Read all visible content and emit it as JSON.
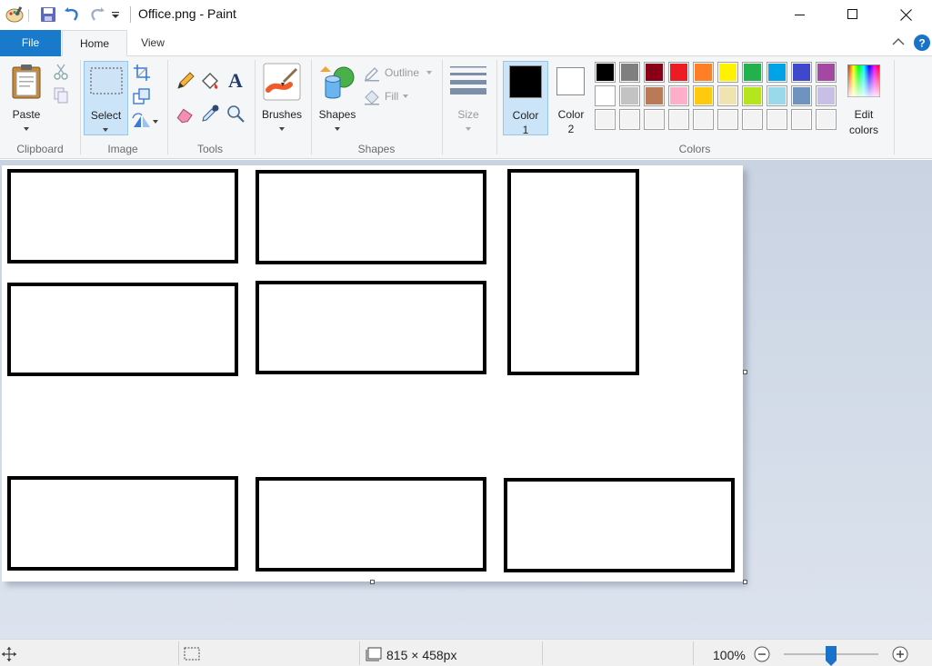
{
  "window": {
    "title": "Office.png - Paint",
    "minimize": "—",
    "maximize": "☐",
    "close": "✕"
  },
  "tabs": {
    "file": "File",
    "home": "Home",
    "view": "View"
  },
  "ribbon": {
    "clipboard": {
      "label": "Clipboard",
      "paste": "Paste"
    },
    "image": {
      "label": "Image",
      "select": "Select"
    },
    "tools": {
      "label": "Tools"
    },
    "brushes": {
      "label": "Brushes"
    },
    "shapes": {
      "label": "Shapes",
      "shapes": "Shapes",
      "outline": "Outline",
      "fill": "Fill"
    },
    "size": {
      "label": "Size"
    },
    "colors": {
      "label": "Colors",
      "color1": "Color",
      "color1_num": "1",
      "color2": "Color",
      "color2_num": "2",
      "edit": "Edit",
      "edit2": "colors",
      "color1_value": "#000000",
      "color2_value": "#ffffff",
      "palette_row1": [
        "#000000",
        "#7f7f7f",
        "#880015",
        "#ed1c24",
        "#ff7f27",
        "#fff200",
        "#22b14c",
        "#00a2e8",
        "#3f48cc",
        "#a349a4"
      ],
      "palette_row2": [
        "#ffffff",
        "#c3c3c3",
        "#b97a57",
        "#ffaec9",
        "#ffc90e",
        "#efe4b0",
        "#b5e61d",
        "#99d9ea",
        "#7092be",
        "#c8bfe7"
      ],
      "palette_row3": [
        "#f3f3f3",
        "#f3f3f3",
        "#f3f3f3",
        "#f3f3f3",
        "#f3f3f3",
        "#f3f3f3",
        "#f3f3f3",
        "#f3f3f3",
        "#f3f3f3",
        "#f3f3f3"
      ]
    }
  },
  "status": {
    "dimensions": "815 × 458px",
    "zoom": "100%"
  }
}
